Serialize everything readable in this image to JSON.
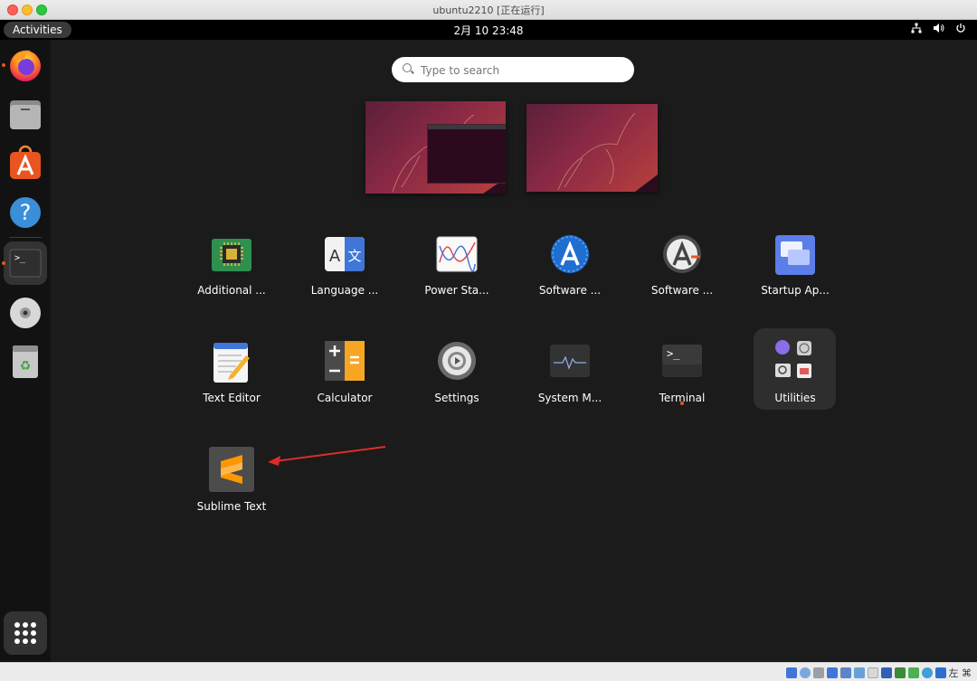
{
  "window": {
    "title": "ubuntu2210 [正在运行]"
  },
  "topbar": {
    "activities": "Activities",
    "clock": "2月 10  23:48"
  },
  "search": {
    "placeholder": "Type to search"
  },
  "apps": [
    {
      "label": "Additional ...",
      "icon": "chip-icon"
    },
    {
      "label": "Language ...",
      "icon": "translate-icon"
    },
    {
      "label": "Power Sta...",
      "icon": "power-stats-icon"
    },
    {
      "label": "Software ...",
      "icon": "software-updater-icon"
    },
    {
      "label": "Software ...",
      "icon": "software-properties-icon"
    },
    {
      "label": "Startup Ap...",
      "icon": "startup-apps-icon"
    },
    {
      "label": "Text Editor",
      "icon": "text-editor-icon"
    },
    {
      "label": "Calculator",
      "icon": "calculator-icon"
    },
    {
      "label": "Settings",
      "icon": "settings-icon"
    },
    {
      "label": "System M...",
      "icon": "system-monitor-icon"
    },
    {
      "label": "Terminal",
      "icon": "terminal-icon"
    },
    {
      "label": "Utilities",
      "icon": "utilities-folder-icon"
    },
    {
      "label": "Sublime Text",
      "icon": "sublime-text-icon"
    }
  ],
  "dock": [
    "firefox-icon",
    "files-icon",
    "app-center-icon",
    "help-icon",
    "terminal-icon",
    "disc-icon",
    "trash-icon",
    "show-apps-icon"
  ],
  "statusbar": {
    "host_key": "左 ⌘"
  },
  "colors": {
    "accent": "#e95420",
    "background": "#1b1b1b",
    "dock": "#121212"
  }
}
